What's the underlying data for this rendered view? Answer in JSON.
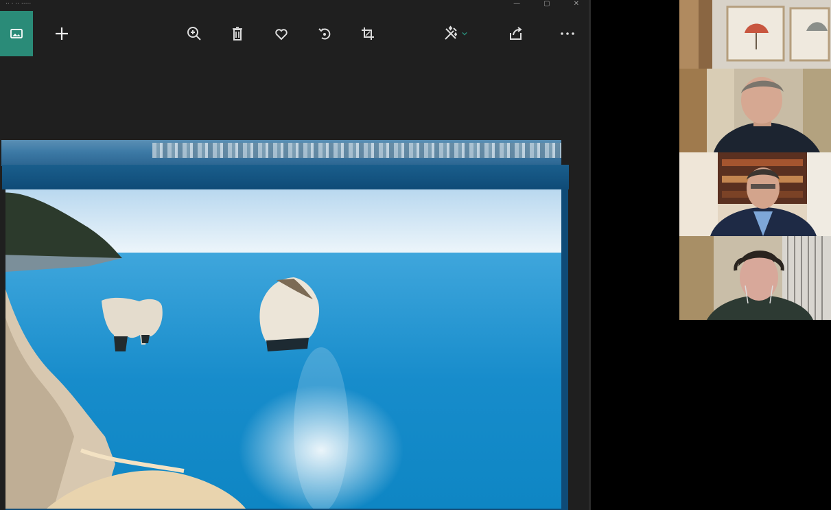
{
  "window": {
    "title": "·· · ·· ·····",
    "controls": [
      "—",
      "▢",
      "✕"
    ]
  },
  "toolbar": {
    "items": [
      {
        "name": "gallery-button",
        "icon": "image-icon"
      },
      {
        "name": "add-button",
        "icon": "plus-icon"
      },
      {
        "name": "zoom-button",
        "icon": "zoom-in-icon"
      },
      {
        "name": "delete-button",
        "icon": "trash-icon"
      },
      {
        "name": "favorite-button",
        "icon": "heart-icon"
      },
      {
        "name": "rotate-button",
        "icon": "rotate-icon"
      },
      {
        "name": "crop-button",
        "icon": "crop-icon"
      },
      {
        "name": "edit-button",
        "icon": "edit-sparkle-icon"
      },
      {
        "name": "share-button",
        "icon": "share-icon"
      },
      {
        "name": "more-button",
        "icon": "more-icon"
      }
    ],
    "accent": "#2a8b78"
  },
  "photo": {
    "subject": "turquoise sea with two rock stacks below white limestone cliffs"
  },
  "participants": [
    {
      "tile": "framed-pictures-wall"
    },
    {
      "tile": "participant-1"
    },
    {
      "tile": "participant-2"
    },
    {
      "tile": "participant-3"
    }
  ],
  "colors": {
    "app_bg": "#1f1f1f",
    "sea": "#1b8fc8",
    "sky": "#dbeaf5"
  }
}
